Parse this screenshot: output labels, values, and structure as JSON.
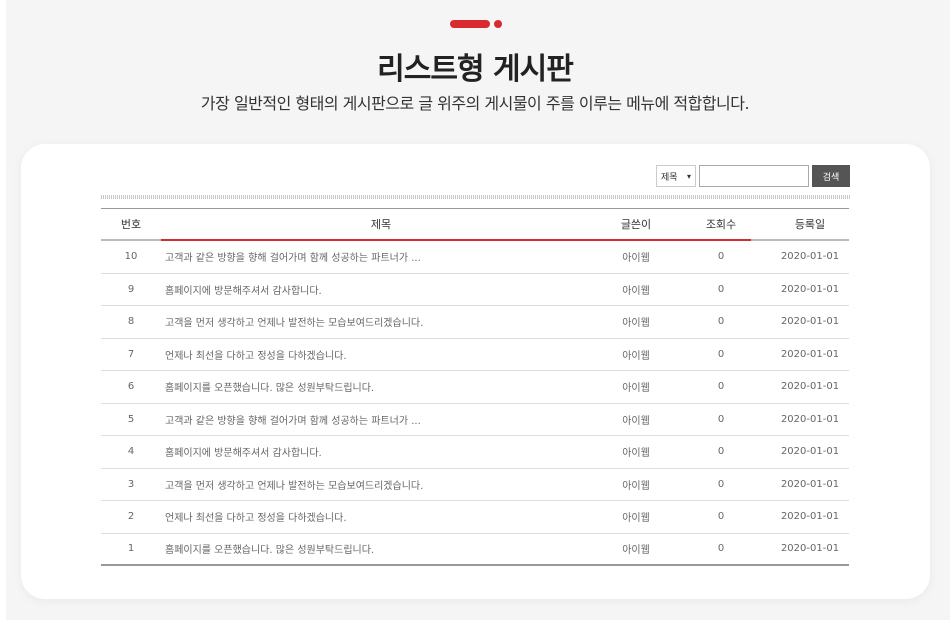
{
  "header": {
    "title": "리스트형 게시판",
    "subtitle": "가장 일반적인 형태의 게시판으로 글 위주의 게시물이 주를 이루는 메뉴에 적합합니다.",
    "accent_color": "#d92b2f"
  },
  "search": {
    "select_value": "제목",
    "input_value": "",
    "button_label": "검색"
  },
  "table": {
    "columns": {
      "no": "번호",
      "title": "제목",
      "author": "글쓴이",
      "views": "조회수",
      "date": "등록일"
    },
    "rows": [
      {
        "no": "10",
        "title": "고객과 같은 방향을 향해 걸어가며 함께 성공하는 파트너가 ...",
        "author": "아이웹",
        "views": "0",
        "date": "2020-01-01"
      },
      {
        "no": "9",
        "title": "홈페이지에 방문해주셔서 감사합니다.",
        "author": "아이웹",
        "views": "0",
        "date": "2020-01-01"
      },
      {
        "no": "8",
        "title": "고객을 먼저 생각하고 언제나 발전하는 모습보여드리겠습니다.",
        "author": "아이웹",
        "views": "0",
        "date": "2020-01-01"
      },
      {
        "no": "7",
        "title": "언제나 최선을 다하고 정성을 다하겠습니다.",
        "author": "아이웹",
        "views": "0",
        "date": "2020-01-01"
      },
      {
        "no": "6",
        "title": "홈페이지를 오픈했습니다. 많은 성원부탁드립니다.",
        "author": "아이웹",
        "views": "0",
        "date": "2020-01-01"
      },
      {
        "no": "5",
        "title": "고객과 같은 방향을 향해 걸어가며 함께 성공하는 파트너가 ...",
        "author": "아이웹",
        "views": "0",
        "date": "2020-01-01"
      },
      {
        "no": "4",
        "title": "홈페이지에 방문해주셔서 감사합니다.",
        "author": "아이웹",
        "views": "0",
        "date": "2020-01-01"
      },
      {
        "no": "3",
        "title": "고객을 먼저 생각하고 언제나 발전하는 모습보여드리겠습니다.",
        "author": "아이웹",
        "views": "0",
        "date": "2020-01-01"
      },
      {
        "no": "2",
        "title": "언제나 최선을 다하고 정성을 다하겠습니다.",
        "author": "아이웹",
        "views": "0",
        "date": "2020-01-01"
      },
      {
        "no": "1",
        "title": "홈페이지를 오픈했습니다. 많은 성원부탁드립니다.",
        "author": "아이웹",
        "views": "0",
        "date": "2020-01-01"
      }
    ]
  }
}
